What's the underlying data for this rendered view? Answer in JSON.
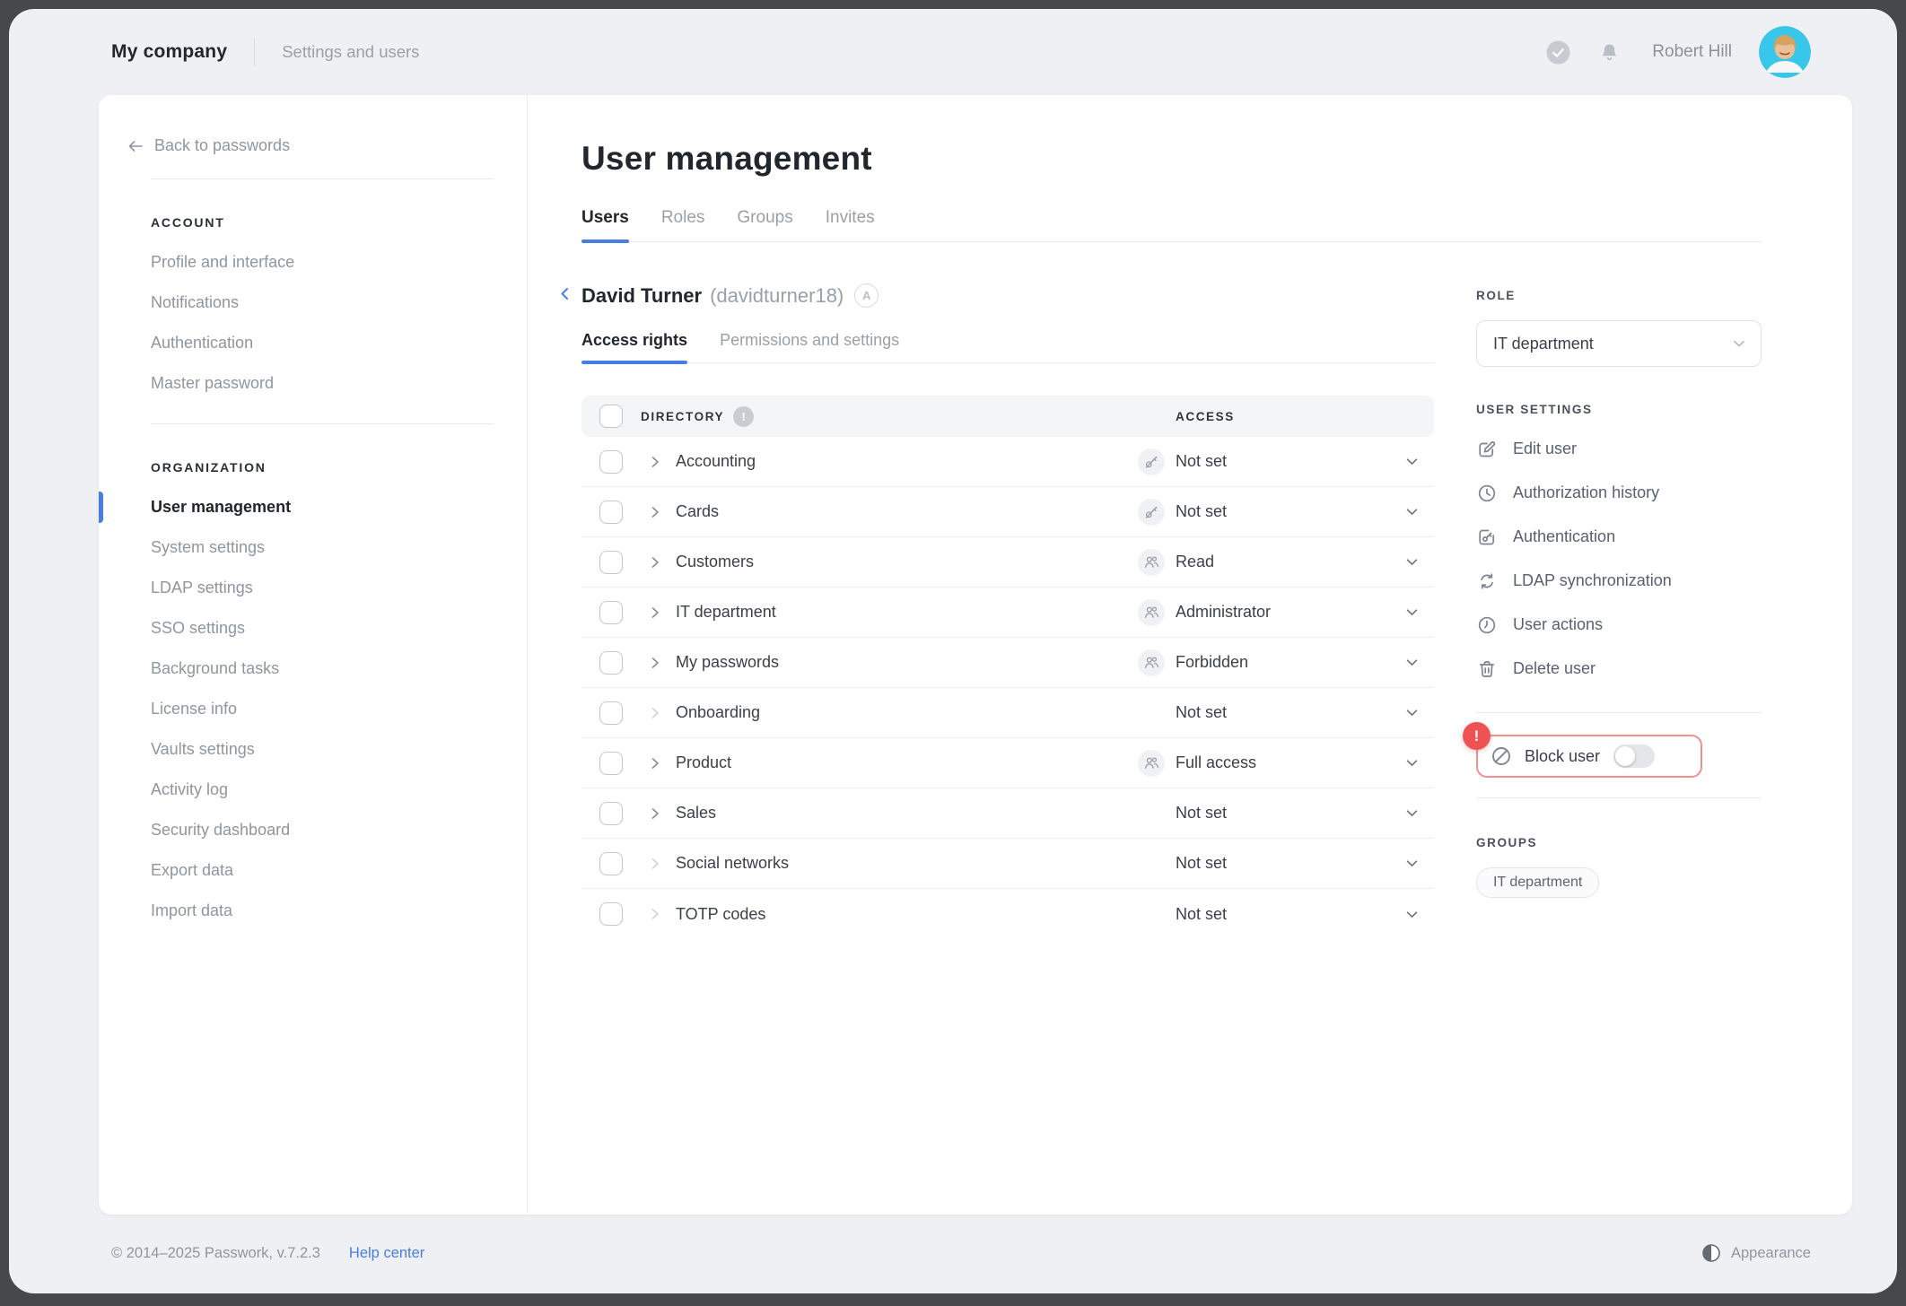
{
  "topbar": {
    "company_name": "My company",
    "section_title": "Settings and users",
    "user_name": "Robert Hill"
  },
  "sidebar": {
    "back_label": "Back to passwords",
    "sections": [
      {
        "heading": "Account",
        "items": [
          {
            "label": "Profile and interface",
            "active": false
          },
          {
            "label": "Notifications",
            "active": false
          },
          {
            "label": "Authentication",
            "active": false
          },
          {
            "label": "Master password",
            "active": false
          }
        ]
      },
      {
        "heading": "Organization",
        "items": [
          {
            "label": "User management",
            "active": true
          },
          {
            "label": "System settings",
            "active": false
          },
          {
            "label": "LDAP settings",
            "active": false
          },
          {
            "label": "SSO settings",
            "active": false
          },
          {
            "label": "Background tasks",
            "active": false
          },
          {
            "label": "License info",
            "active": false
          },
          {
            "label": "Vaults settings",
            "active": false
          },
          {
            "label": "Activity log",
            "active": false
          },
          {
            "label": "Security dashboard",
            "active": false
          },
          {
            "label": "Export data",
            "active": false
          },
          {
            "label": "Import data",
            "active": false
          }
        ]
      }
    ]
  },
  "main": {
    "page_title": "User management",
    "tabs": [
      {
        "label": "Users",
        "active": true
      },
      {
        "label": "Roles",
        "active": false
      },
      {
        "label": "Groups",
        "active": false
      },
      {
        "label": "Invites",
        "active": false
      }
    ],
    "user_header": {
      "name": "David Turner",
      "login": "(davidturner18)",
      "badge": "A"
    },
    "subtabs": [
      {
        "label": "Access rights",
        "active": true
      },
      {
        "label": "Permissions and settings",
        "active": false
      }
    ],
    "table": {
      "directory_header": "Directory",
      "info_icon": "!",
      "access_header": "Access",
      "rows": [
        {
          "name": "Accounting",
          "access": "Not set",
          "icon": "key-slash",
          "children": true
        },
        {
          "name": "Cards",
          "access": "Not set",
          "icon": "key-slash",
          "children": true
        },
        {
          "name": "Customers",
          "access": "Read",
          "icon": "users",
          "children": true
        },
        {
          "name": "IT department",
          "access": "Administrator",
          "icon": "users",
          "children": true
        },
        {
          "name": "My passwords",
          "access": "Forbidden",
          "icon": "users",
          "children": true
        },
        {
          "name": "Onboarding",
          "access": "Not set",
          "icon": "none",
          "children": false
        },
        {
          "name": "Product",
          "access": "Full access",
          "icon": "users",
          "children": true
        },
        {
          "name": "Sales",
          "access": "Not set",
          "icon": "none",
          "children": true
        },
        {
          "name": "Social networks",
          "access": "Not set",
          "icon": "none",
          "children": false
        },
        {
          "name": "TOTP codes",
          "access": "Not set",
          "icon": "none",
          "children": false
        }
      ]
    }
  },
  "panel": {
    "role_heading": "Role",
    "role_value": "IT department",
    "settings_heading": "User settings",
    "actions": [
      {
        "label": "Edit user"
      },
      {
        "label": "Authorization history"
      },
      {
        "label": "Authentication"
      },
      {
        "label": "LDAP synchronization"
      },
      {
        "label": "User actions"
      },
      {
        "label": "Delete user"
      }
    ],
    "block_user": {
      "label": "Block user",
      "enabled": false,
      "alert": "!"
    },
    "groups_heading": "Groups",
    "groups": [
      "IT department"
    ]
  },
  "footer": {
    "copyright": "© 2014–2025 Passwork, v.7.2.3",
    "help_link": "Help center",
    "appearance_label": "Appearance"
  },
  "colors": {
    "accent_blue": "#4a7de2",
    "alert_red": "#ee5253",
    "alert_border": "#f09090",
    "avatar_bg": "#38c7eb"
  }
}
